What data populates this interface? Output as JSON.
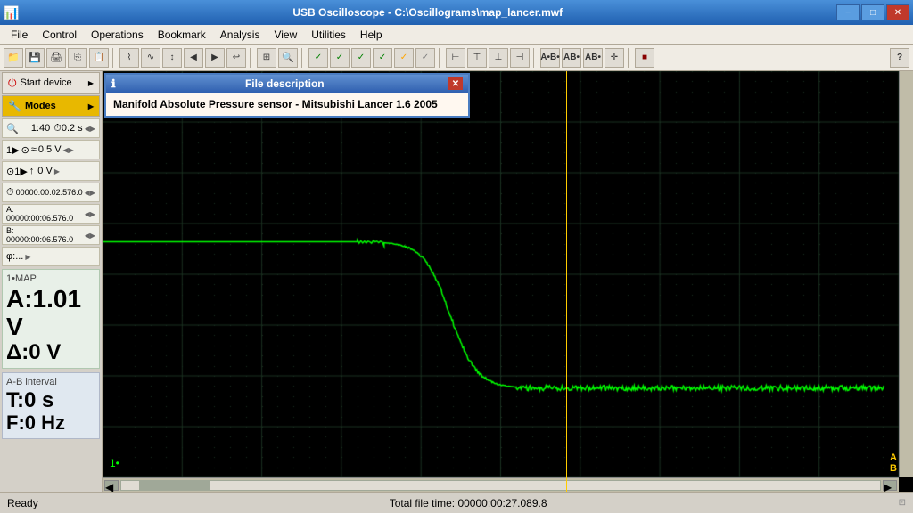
{
  "titleBar": {
    "icon": "oscilloscope-icon",
    "title": "USB Oscilloscope - C:\\Oscillograms\\map_lancer.mwf",
    "minBtn": "−",
    "maxBtn": "□",
    "closeBtn": "✕"
  },
  "menuBar": {
    "items": [
      "File",
      "Control",
      "Operations",
      "Bookmark",
      "Analysis",
      "View",
      "Utilities",
      "Help"
    ]
  },
  "toolbar": {
    "groups": [
      [
        "folder-open",
        "save",
        "print",
        "copy",
        "paste"
      ],
      [
        "zoom-in",
        "zoom-out",
        "zoom-fit",
        "arrow-left",
        "arrow-right",
        "undo"
      ],
      [
        "zoom-region",
        "zoom-cursor"
      ],
      [
        "check1",
        "check2",
        "check3",
        "check4",
        "check5",
        "check6"
      ],
      [
        "measure1",
        "measure2",
        "measure3",
        "measure4"
      ],
      [
        "A-label",
        "B-label",
        "AB-label",
        "cursor-btn"
      ],
      [
        "stop-btn"
      ],
      [
        "question-btn"
      ]
    ]
  },
  "leftPanel": {
    "startDevice": "Start device",
    "modes": "Modes",
    "timeDiv": "1:40",
    "timeStep": "0.2 s",
    "voltDiv": "0.5 V",
    "triggerVolt": "0 V",
    "timeStamp": "00000:00:02.576.0",
    "cursorA": "A: 00000:00:06.576.0",
    "cursorB": "B: 00000:00:06.576.0",
    "phi": "φ:...",
    "channelLabel": "1•MAP",
    "readingA": "A:1.01 V",
    "readingDelta": "Δ:0 V",
    "abInterval": "A-B interval",
    "readingT": "T:0 s",
    "readingF": "F:0 Hz"
  },
  "fileDesc": {
    "title": "File description",
    "content": "Manifold Absolute Pressure sensor - Mitsubishi Lancer 1.6 2005",
    "closeBtn": "✕"
  },
  "oscilloscope": {
    "markerLabel": "1•",
    "abMarker": "A\nB",
    "cursorLineX": 520
  },
  "statusBar": {
    "ready": "Ready",
    "totalTime": "Total file time: 00000:00:27.089.8"
  }
}
